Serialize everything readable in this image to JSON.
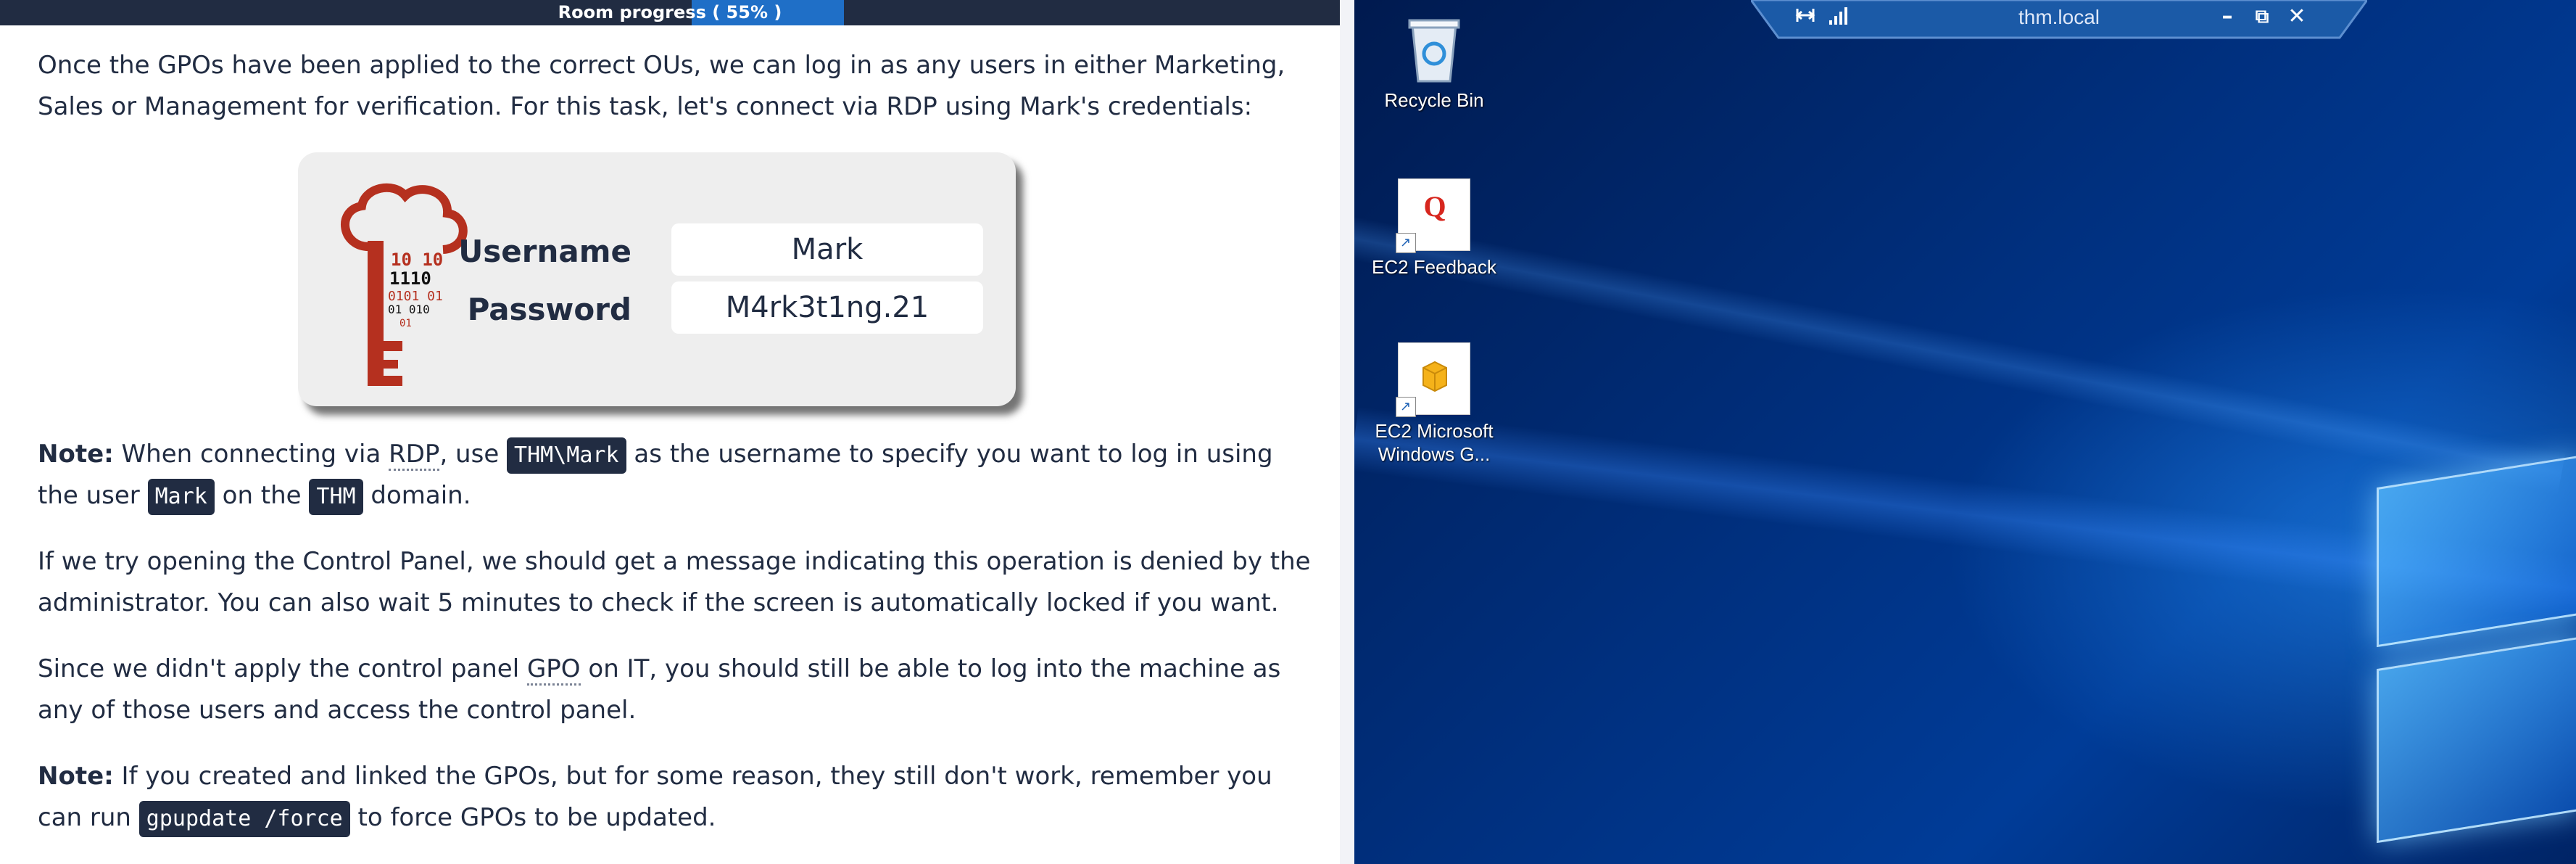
{
  "progress": {
    "label": "Room progress ( 55% )",
    "value": 0.55
  },
  "intro": {
    "line": "Once the GPOs have been applied to the correct OUs, we can log in as any users in either Marketing, Sales or Management for verification. For this task, let's connect via RDP using Mark's credentials:"
  },
  "credentials": {
    "username_label": "Username",
    "username_value": "Mark",
    "password_label": "Password",
    "password_value": "M4rk3t1ng.21",
    "key_bits": [
      "10 10",
      "1110",
      "0101 01",
      "01 010",
      "01"
    ]
  },
  "note1": {
    "strong": "Note:",
    "text1": " When connecting via ",
    "abbr": "RDP",
    "text2": ", use ",
    "code1": "THM\\Mark",
    "text3": " as the username to specify you want to log in using the user ",
    "code2": "Mark",
    "text4": " on the ",
    "code3": "THM",
    "text5": " domain."
  },
  "para2": "If we try opening the Control Panel, we should get a message indicating this operation is denied by the administrator. You can also wait 5 minutes to check if the screen is automatically locked if you want.",
  "para3": {
    "text1": "Since we didn't apply the control panel ",
    "abbr": "GPO",
    "text2": " on IT, you should still be able to log into the machine as any of those users and access the control panel."
  },
  "note2": {
    "strong": "Note:",
    "text1": " If you created and linked the GPOs, but for some reason, they still don't work, remember you can run ",
    "code": "gpupdate /force",
    "text2": " to force GPOs to be updated."
  },
  "desktop": {
    "icons": [
      {
        "label": "Recycle Bin"
      },
      {
        "label": "EC2 Feedback",
        "glyph": "Q"
      },
      {
        "label_line1": "EC2 Microsoft",
        "label_line2": "Windows G..."
      }
    ]
  },
  "rdp_bar": {
    "title": "thm.local",
    "pin_icon": "pin-icon",
    "signal_icon": "signal-icon",
    "minimize": "–",
    "restore": "⧉",
    "close": "✕"
  },
  "colors": {
    "text": "#212c42",
    "progress_bg": "#212c42",
    "progress_fill": "#1f6fc7",
    "code_bg": "#212c42",
    "key_red": "#b5301f",
    "desktop_blue": "#003c98"
  }
}
